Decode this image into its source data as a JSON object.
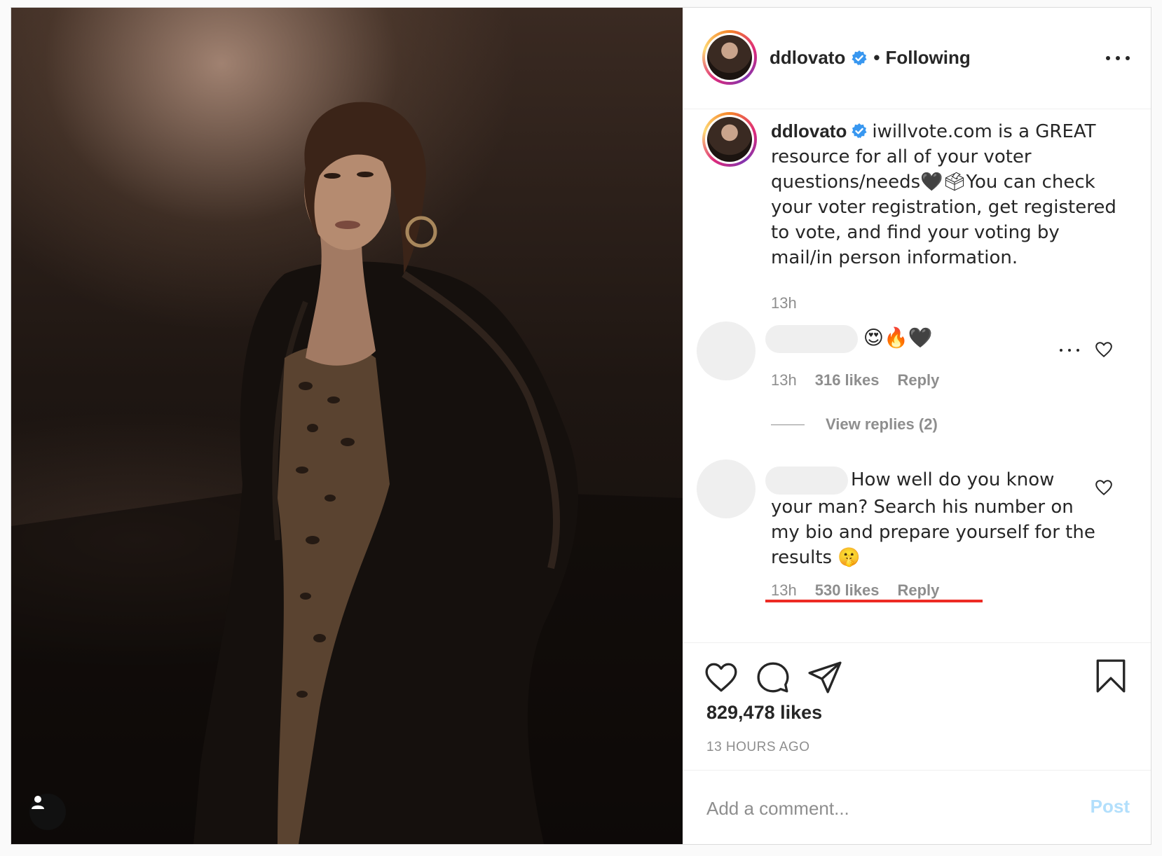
{
  "post": {
    "username": "ddlovato",
    "follow_status": "Following",
    "separator": "•"
  },
  "caption": {
    "username": "ddlovato",
    "text": "iwillvote.com is a GREAT resource for all of your voter questions/needs🖤🗳You can check your voter registration, get registered to vote, and find your voting by mail/in person information.",
    "time": "13h"
  },
  "comments": [
    {
      "text": "😍🔥🖤",
      "time": "13h",
      "likes": "316 likes",
      "reply_label": "Reply",
      "view_replies": "View replies (2)"
    },
    {
      "text": "How well do you know your man? Search his number on my bio and prepare yourself for the results 🤫",
      "time": "13h",
      "likes": "530 likes",
      "reply_label": "Reply"
    }
  ],
  "stats": {
    "likes": "829,478 likes",
    "posted_ago": "13 HOURS AGO"
  },
  "comment_box": {
    "placeholder": "Add a comment...",
    "post_label": "Post"
  },
  "icons": {
    "verified": "verified-badge-icon",
    "more": "more-options-icon",
    "heart": "heart-icon",
    "comment": "comment-icon",
    "share": "share-icon",
    "save": "bookmark-icon",
    "user_tag": "user-tag-icon"
  },
  "colors": {
    "verified_blue": "#3897f0",
    "post_button_disabled": "#b2dffc",
    "annotation_underline": "#ed2b24"
  }
}
